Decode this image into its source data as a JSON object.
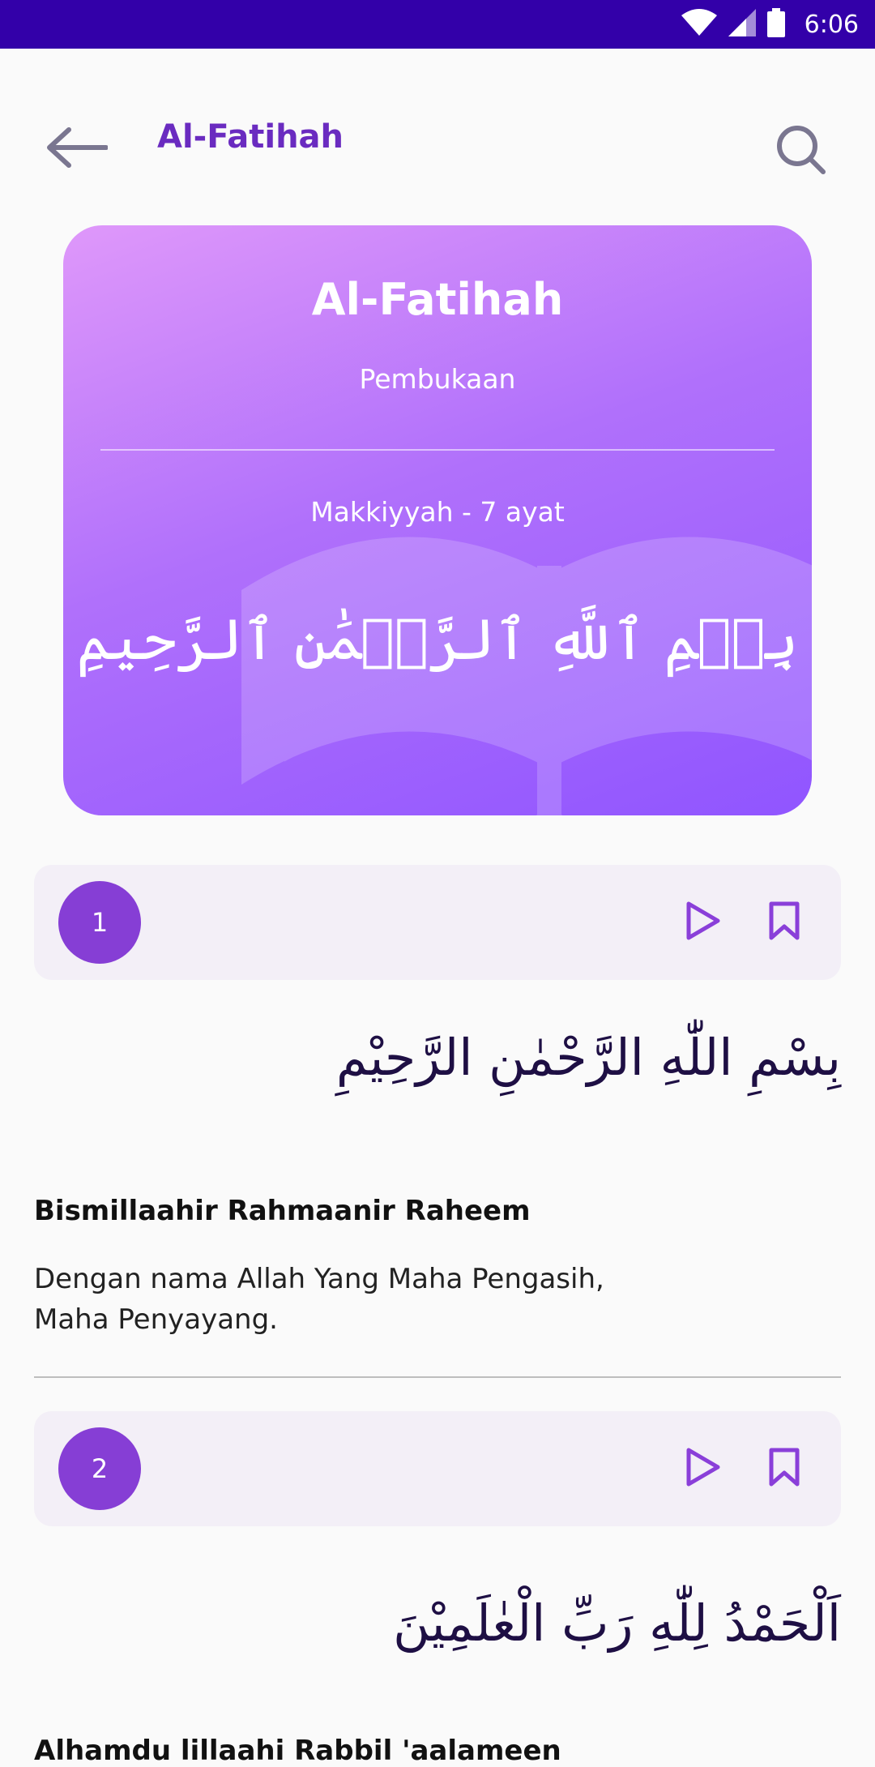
{
  "status_bar": {
    "time": "6:06",
    "wifi_icon": "wifi-icon",
    "signal_icon": "signal-icon",
    "battery_icon": "battery-icon"
  },
  "app_bar": {
    "title": "Al-Fatihah",
    "back_icon": "arrow-left-icon",
    "search_icon": "search-icon"
  },
  "colors": {
    "status_bar": "#3300a9",
    "accent": "#863ed5",
    "title": "#6a2bc0",
    "hero_start": "#df98fa",
    "hero_end": "#9055ff",
    "ayah_bar_bg": "#f3eff7",
    "arabic_text": "#1e0f44"
  },
  "hero": {
    "title": "Al-Fatihah",
    "subtitle": "Pembukaan",
    "meta": "Makkiyyah - 7 ayat",
    "bismillah": "بِسۡمِ ٱللَّهِ ٱلرَّحۡمَٰنِ ٱلرَّحِيمِ"
  },
  "ayahs": [
    {
      "number": "1",
      "arabic": "بِسْمِ اللّٰهِ الرَّحْمٰنِ الرَّحِيْمِ",
      "latin": "Bismillaahir Rahmaanir Raheem",
      "translation": "Dengan nama Allah Yang Maha Pengasih, Maha Penyayang."
    },
    {
      "number": "2",
      "arabic": "اَلْحَمْدُ لِلّٰهِ رَبِّ الْعٰلَمِيْنَ",
      "latin": "Alhamdu lillaahi Rabbil 'aalameen"
    }
  ]
}
